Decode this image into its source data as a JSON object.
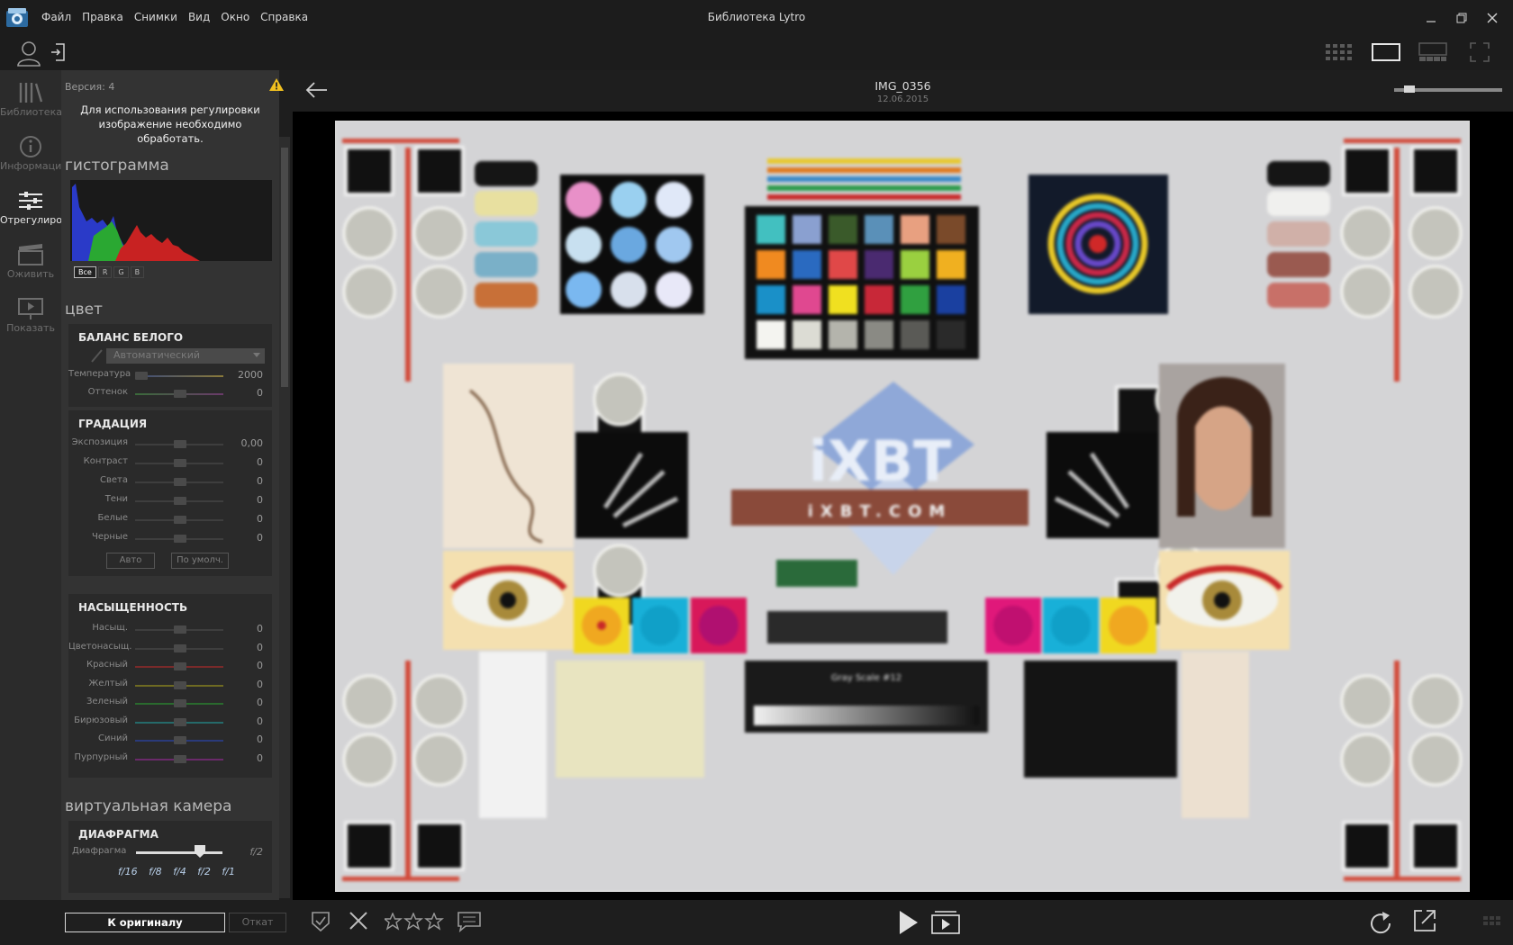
{
  "window": {
    "title": "Библиотека Lytro",
    "menu": [
      "Файл",
      "Правка",
      "Снимки",
      "Вид",
      "Окно",
      "Справка"
    ]
  },
  "nav": [
    {
      "label": "Библиотека",
      "icon": "library-icon",
      "active": false
    },
    {
      "label": "Информация",
      "icon": "info-icon",
      "active": false
    },
    {
      "label": "Отрегулировать",
      "icon": "adjust-icon",
      "active": true
    },
    {
      "label": "Оживить",
      "icon": "animate-icon",
      "active": false
    },
    {
      "label": "Показать",
      "icon": "present-icon",
      "active": false
    }
  ],
  "panel": {
    "version": "Версия: 4",
    "notice": "Для использования регулировки изображение необходимо обработать.",
    "histogram": {
      "title": "гистограмма",
      "channels": [
        "Все",
        "R",
        "G",
        "B"
      ],
      "selected": "Все"
    },
    "color": {
      "title": "цвет",
      "white_balance": {
        "title": "БАЛАНС БЕЛОГО",
        "preset": "Автоматический",
        "rows": [
          {
            "label": "Температура",
            "value": "2000",
            "level": 0.05
          },
          {
            "label": "Оттенок",
            "value": "0",
            "level": 0.5
          }
        ]
      },
      "gradation": {
        "title": "ГРАДАЦИЯ",
        "rows": [
          {
            "label": "Экспозиция",
            "value": "0,00"
          },
          {
            "label": "Контраст",
            "value": "0"
          },
          {
            "label": "Света",
            "value": "0"
          },
          {
            "label": "Тени",
            "value": "0"
          },
          {
            "label": "Белые",
            "value": "0"
          },
          {
            "label": "Черные",
            "value": "0"
          }
        ],
        "auto_label": "Авто",
        "default_label": "По умолч."
      },
      "saturation": {
        "title": "НАСЫЩЕННОСТЬ",
        "rows": [
          {
            "label": "Насыщ.",
            "value": "0",
            "color": "#3e3e3e"
          },
          {
            "label": "Цветонасыщ.",
            "value": "0",
            "color": "#3e3e3e"
          },
          {
            "label": "Красный",
            "value": "0",
            "color": "#7a2a2a"
          },
          {
            "label": "Желтый",
            "value": "0",
            "color": "#6e6a22"
          },
          {
            "label": "Зеленый",
            "value": "0",
            "color": "#2a6a2e"
          },
          {
            "label": "Бирюзовый",
            "value": "0",
            "color": "#256a6a"
          },
          {
            "label": "Синий",
            "value": "0",
            "color": "#2a3a7a"
          },
          {
            "label": "Пурпурный",
            "value": "0",
            "color": "#6a2a6a"
          }
        ]
      }
    },
    "virtual_camera": {
      "title": "виртуальная камера",
      "aperture": {
        "title": "ДИАФРАГМА",
        "label": "Диафрагма",
        "value": "f/2",
        "ticks": [
          "f/16",
          "f/8",
          "f/4",
          "f/2",
          "f/1"
        ],
        "level": 0.72
      }
    },
    "to_original": "К оригиналу",
    "undo": "Откат"
  },
  "viewer": {
    "image_name": "IMG_0356",
    "image_date": "12.06.2015",
    "zoom_level": 0.1,
    "photo_text": [
      "iXBT",
      "iXBT.COM",
      "Gray Scale #12"
    ]
  },
  "colors": {
    "accent": "#e6e6e6",
    "panel": "#333333",
    "warning": "#f0c020"
  }
}
